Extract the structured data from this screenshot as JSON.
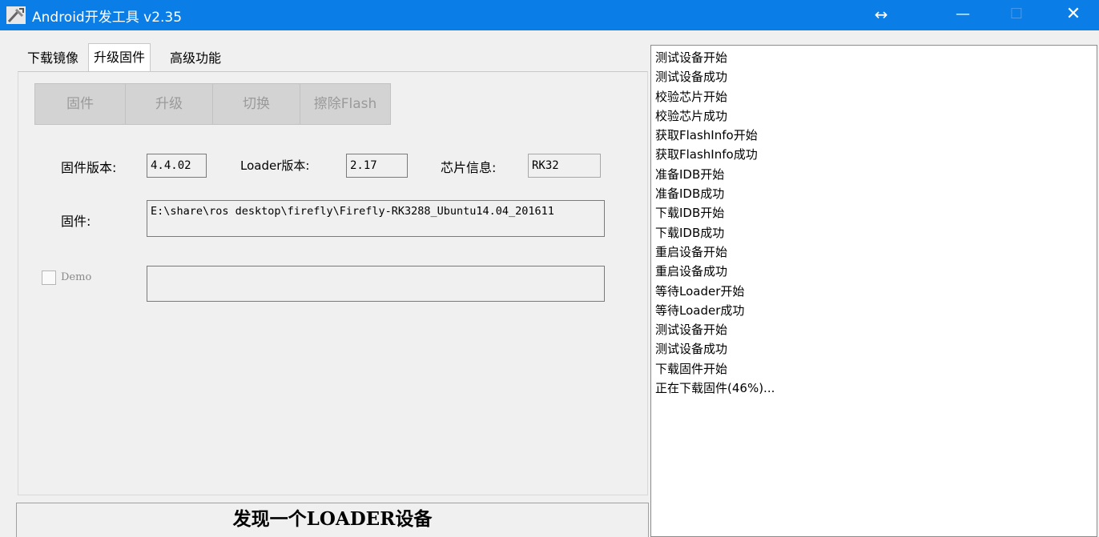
{
  "window": {
    "title": "Android开发工具 v2.35",
    "controls": {
      "move": "↔",
      "minimize": "—",
      "maximize": "☐",
      "close": "✕"
    }
  },
  "tabs": [
    "下载镜像",
    "升级固件",
    "高级功能"
  ],
  "active_tab": "升级固件",
  "buttons": {
    "firmware": "固件",
    "upgrade": "升级",
    "switch": "切换",
    "erase": "擦除Flash"
  },
  "info": {
    "fw_version_label": "固件版本:",
    "fw_version_value": "4.4.02",
    "loader_version_label": "Loader版本:",
    "loader_version_value": "2.17",
    "chip_label": "芯片信息:",
    "chip_value": "RK32",
    "firmware_label": "固件:",
    "firmware_path": "E:\\share\\ros desktop\\firefly\\Firefly-RK3288_Ubuntu14.04_201611"
  },
  "demo": {
    "label": "Demo",
    "checked": false,
    "value": ""
  },
  "status": "发现一个LOADER设备",
  "log": [
    "测试设备开始",
    "测试设备成功",
    "校验芯片开始",
    "校验芯片成功",
    "获取FlashInfo开始",
    "获取FlashInfo成功",
    "准备IDB开始",
    "准备IDB成功",
    "下载IDB开始",
    "下载IDB成功",
    "重启设备开始",
    "重启设备成功",
    "等待Loader开始",
    "等待Loader成功",
    "测试设备开始",
    "测试设备成功",
    "下载固件开始",
    "正在下载固件(46%)..."
  ],
  "colors": {
    "titlebar": "#0a7ee6",
    "disabled_button": "#d3d3d3"
  }
}
